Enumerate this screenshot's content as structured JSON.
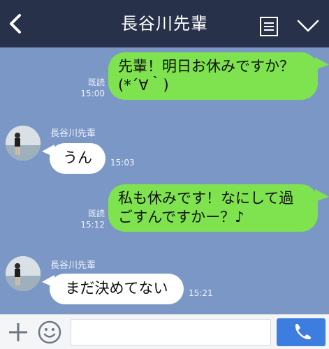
{
  "header": {
    "title": "長谷川先輩",
    "back_icon": "chevron-left-icon",
    "notes_icon": "notes-icon",
    "menu_icon": "chevron-down-icon"
  },
  "messages": [
    {
      "type": "sent",
      "lines": [
        "先輩！明日お休みですか？",
        "(*´∀｀)"
      ],
      "read_label": "既読",
      "time": "15:00"
    },
    {
      "type": "received",
      "sender": "長谷川先輩",
      "text": "うん",
      "time": "15:03"
    },
    {
      "type": "sent",
      "lines": [
        "私も休みです！なにして過",
        "ごすんですかー？♪"
      ],
      "read_label": "既読",
      "time": "15:12"
    },
    {
      "type": "received",
      "sender": "長谷川先輩",
      "text": "まだ決めてない",
      "time": "15:21"
    }
  ],
  "input_bar": {
    "plus_icon": "plus-icon",
    "emoji_icon": "emoji-icon",
    "input_value": "",
    "input_placeholder": "",
    "call_icon": "phone-icon"
  },
  "colors": {
    "header_bg": "#27324a",
    "chat_bg": "#7b97c6",
    "sent_bubble": "#7fe24f",
    "received_bubble": "#ffffff",
    "call_button": "#3e7de0"
  }
}
